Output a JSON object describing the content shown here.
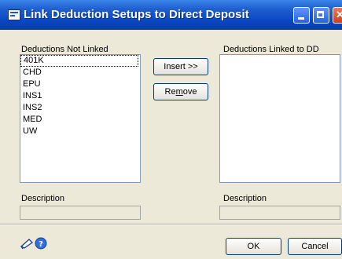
{
  "window": {
    "title": "Link Deduction Setups to Direct Deposit"
  },
  "left": {
    "label": "Deductions Not Linked",
    "items": [
      "401K",
      "CHD",
      "EPU",
      "INS1",
      "INS2",
      "MED",
      "UW"
    ],
    "description_label": "Description"
  },
  "right": {
    "label": "Deductions Linked to DD",
    "items": [],
    "description_label": "Description"
  },
  "buttons": {
    "insert": "Insert >>",
    "remove": "Remove",
    "ok": "OK",
    "cancel": "Cancel"
  },
  "icons": {
    "note": "note-icon",
    "help": "help-icon"
  }
}
